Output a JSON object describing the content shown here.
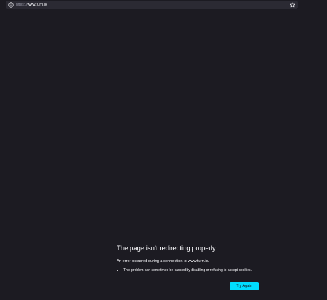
{
  "address_bar": {
    "url_scheme": "https://",
    "url_host": "www.turn.io",
    "info_icon": "info-circle-icon",
    "bookmark_icon": "star-icon"
  },
  "error_page": {
    "title": "The page isn’t redirecting properly",
    "description": "An error occurred during a connection to www.turn.io.",
    "details": [
      "This problem can sometimes be caused by disabling or refusing to accept cookies."
    ],
    "try_again_label": "Try Again"
  },
  "colors": {
    "background": "#1c1b22",
    "urlbar": "#2b2a33",
    "text": "#fbfbfe",
    "accent_button": "#00ddff"
  }
}
